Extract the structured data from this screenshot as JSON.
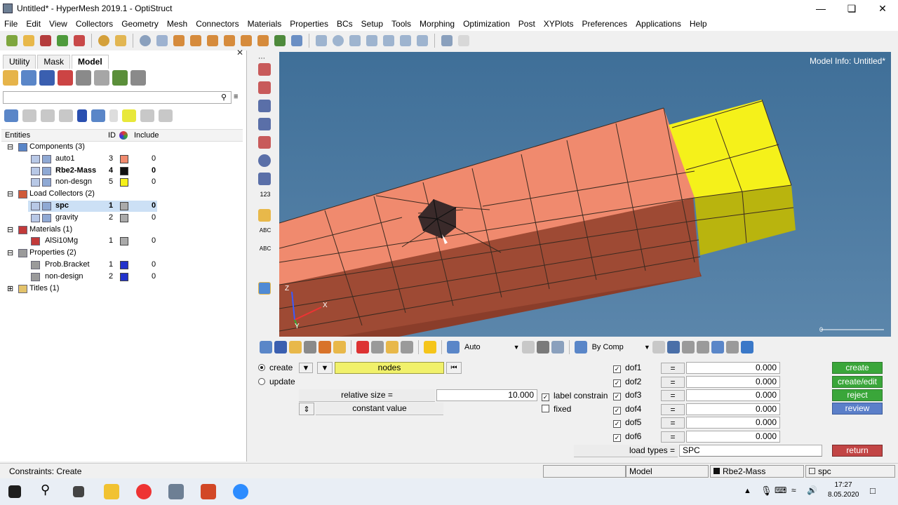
{
  "window": {
    "title": "Untitled* - HyperMesh 2019.1 - OptiStruct"
  },
  "menu": [
    "File",
    "Edit",
    "View",
    "Collectors",
    "Geometry",
    "Mesh",
    "Connectors",
    "Materials",
    "Properties",
    "BCs",
    "Setup",
    "Tools",
    "Morphing",
    "Optimization",
    "Post",
    "XYPlots",
    "Preferences",
    "Applications",
    "Help"
  ],
  "browser": {
    "tabs": [
      "Utility",
      "Mask",
      "Model"
    ],
    "headers": {
      "entities": "Entities",
      "id": "ID",
      "include": "Include"
    },
    "tree": [
      {
        "label": "Components (3)"
      },
      {
        "label": "auto1",
        "id": "3",
        "include": "0",
        "color": "#f08a6e"
      },
      {
        "label": "Rbe2-Mass",
        "id": "4",
        "include": "0",
        "color": "#111111"
      },
      {
        "label": "non-desgn",
        "id": "5",
        "include": "0",
        "color": "#f5f11a"
      },
      {
        "label": "Load Collectors (2)"
      },
      {
        "label": "spc",
        "id": "1",
        "include": "0",
        "color": "#aaaaaa"
      },
      {
        "label": "gravity",
        "id": "2",
        "include": "0",
        "color": "#aaaaaa"
      },
      {
        "label": "Materials (1)"
      },
      {
        "label": "AlSi10Mg",
        "id": "1",
        "include": "0",
        "color": "#aaaaaa"
      },
      {
        "label": "Properties (2)"
      },
      {
        "label": "Prob.Bracket",
        "id": "1",
        "include": "0",
        "color": "#2233cc"
      },
      {
        "label": "non-design",
        "id": "2",
        "include": "0",
        "color": "#2233cc"
      },
      {
        "label": "Titles (1)"
      }
    ]
  },
  "viewport": {
    "model_info": "Model Info: Untitled*",
    "axis_z": "Z",
    "axis_x": "X",
    "axis_y": "Y",
    "vtoolbar_123": "123",
    "vtoolbar_abc": "ABC",
    "scale_zero": "0"
  },
  "bottom_toolbar": {
    "auto": "Auto",
    "by_comp": "By Comp"
  },
  "panel": {
    "create": "create",
    "update": "update",
    "selector": "nodes",
    "relative_size_label": "relative size =",
    "relative_size_value": "10.000",
    "constant_value": "constant value",
    "label_constraints": "label constrain",
    "fixed": "fixed",
    "dofs": [
      {
        "name": "dof1",
        "eq": "=",
        "value": "0.000"
      },
      {
        "name": "dof2",
        "eq": "=",
        "value": "0.000"
      },
      {
        "name": "dof3",
        "eq": "=",
        "value": "0.000"
      },
      {
        "name": "dof4",
        "eq": "=",
        "value": "0.000"
      },
      {
        "name": "dof5",
        "eq": "=",
        "value": "0.000"
      },
      {
        "name": "dof6",
        "eq": "=",
        "value": "0.000"
      }
    ],
    "load_types_label": "load types =",
    "load_types_value": "SPC",
    "buttons": {
      "create": "create",
      "create_edit": "create/edit",
      "reject": "reject",
      "review": "review",
      "return": "return"
    }
  },
  "status": {
    "text": "Constraints: Create",
    "model": "Model",
    "component": "Rbe2-Mass",
    "collector": "spc"
  },
  "taskbar": {
    "time": "17:27",
    "date": "8.05.2020"
  },
  "colors": {
    "component_auto1": "#f08a6e",
    "component_nondesign": "#f5f11a",
    "background_top": "#3f6f98",
    "button_green": "#3aa63a",
    "button_blue": "#5b7fc9",
    "button_red": "#c24545"
  }
}
